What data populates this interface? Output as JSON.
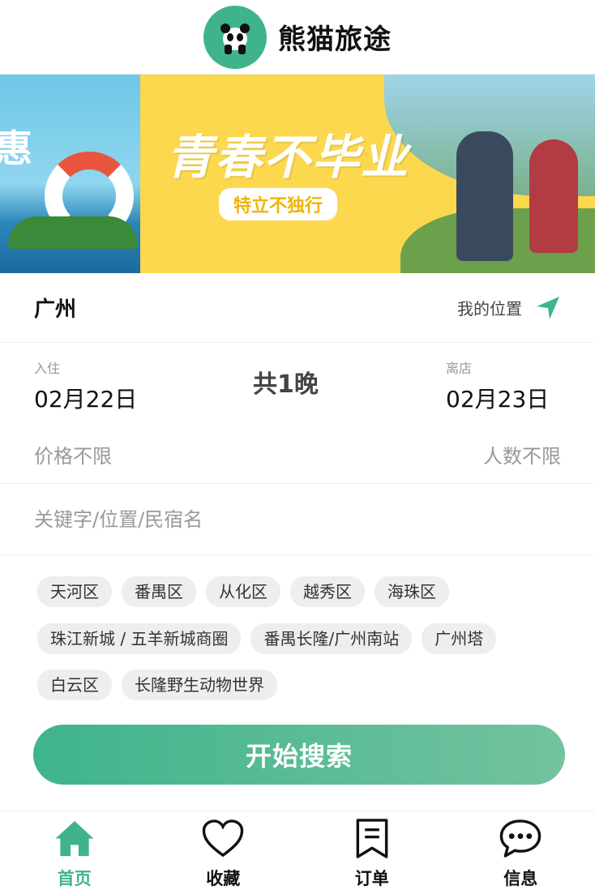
{
  "app": {
    "title": "熊猫旅途",
    "accent": "#3fb48c"
  },
  "banner": {
    "slogan": "青春不毕业",
    "subtitle": "特立不独行",
    "left_text": "惠",
    "slide_count": 3,
    "active_slide": 3
  },
  "location": {
    "city": "广州",
    "my_location_label": "我的位置"
  },
  "dates": {
    "checkin_label": "入住",
    "checkin_value": "02月22日",
    "nights": "共1晚",
    "checkout_label": "离店",
    "checkout_value": "02月23日"
  },
  "filters": {
    "price": "价格不限",
    "guests": "人数不限"
  },
  "search": {
    "placeholder": "关键字/位置/民宿名",
    "value": ""
  },
  "tags": [
    "天河区",
    "番禺区",
    "从化区",
    "越秀区",
    "海珠区",
    "珠江新城 / 五羊新城商圈",
    "番禺长隆/广州南站",
    "广州塔",
    "白云区",
    "长隆野生动物世界"
  ],
  "search_button": "开始搜索",
  "tabbar": [
    {
      "label": "首页",
      "icon": "home-icon",
      "active": true
    },
    {
      "label": "收藏",
      "icon": "heart-icon",
      "active": false
    },
    {
      "label": "订单",
      "icon": "bookmark-list-icon",
      "active": false
    },
    {
      "label": "信息",
      "icon": "chat-bubble-icon",
      "active": false
    }
  ]
}
